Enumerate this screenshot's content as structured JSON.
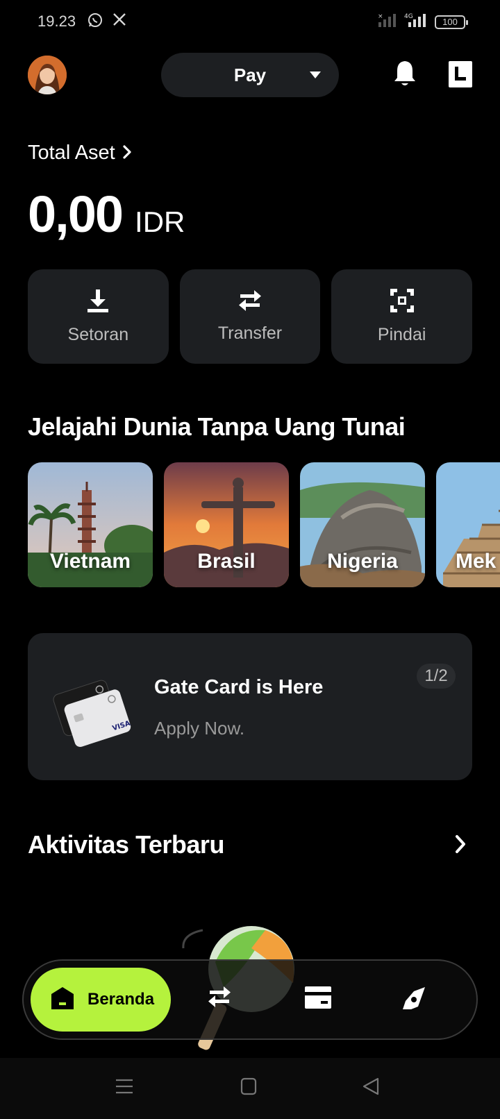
{
  "status_bar": {
    "time": "19.23",
    "icons": [
      "whatsapp-icon",
      "x-icon",
      "signal-icon",
      "4g-signal-icon"
    ],
    "battery": "100"
  },
  "header": {
    "selector_label": "Pay",
    "icons": [
      "bell-icon",
      "exchange-logo-icon"
    ]
  },
  "balance": {
    "label": "Total Aset",
    "value": "0,00",
    "currency": "IDR"
  },
  "actions": [
    {
      "label": "Setoran",
      "icon": "download-icon"
    },
    {
      "label": "Transfer",
      "icon": "swap-arrows-icon"
    },
    {
      "label": "Pindai",
      "icon": "scan-icon"
    }
  ],
  "explore": {
    "title": "Jelajahi Dunia Tanpa Uang Tunai",
    "countries": [
      {
        "name": "Vietnam"
      },
      {
        "name": "Brasil"
      },
      {
        "name": "Nigeria"
      },
      {
        "name": "Mek"
      }
    ]
  },
  "promo": {
    "title": "Gate Card is Here",
    "subtitle": "Apply Now.",
    "page_indicator": "1/2",
    "card_brand": "VISA"
  },
  "activity": {
    "title": "Aktivitas Terbaru"
  },
  "bottom_nav": {
    "home_label": "Beranda",
    "items": [
      "home-icon",
      "swap-arrows-icon",
      "card-icon",
      "compass-icon"
    ]
  },
  "colors": {
    "background": "#000000",
    "surface": "#1d1f22",
    "accent": "#b5f23d",
    "muted_text": "#bdbdbd"
  }
}
